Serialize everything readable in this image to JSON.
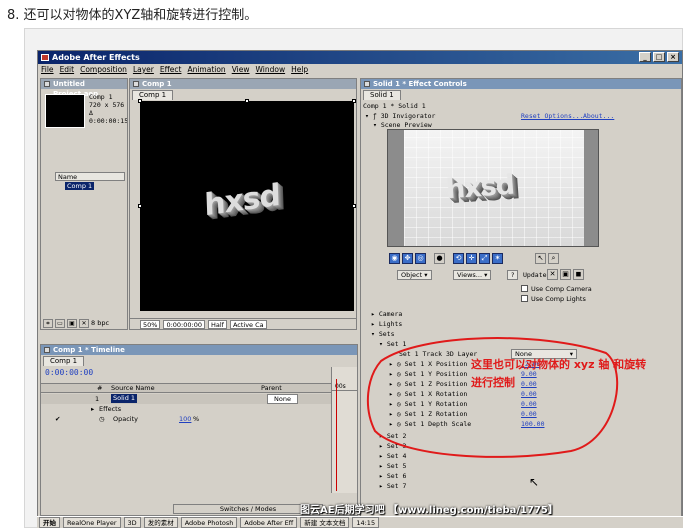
{
  "caption": "8. 还可以对物体的XYZ轴和旋转进行控制。",
  "app": {
    "title": "Adobe After Effects",
    "window_buttons": [
      "_",
      "□",
      "×"
    ],
    "menu": [
      "File",
      "Edit",
      "Composition",
      "Layer",
      "Effect",
      "Animation",
      "View",
      "Window",
      "Help"
    ]
  },
  "project": {
    "title": "Untitled Project.aep",
    "info": [
      "Comp 1",
      "720 x 576",
      "Δ 0:00:00:15"
    ],
    "column": "Name",
    "item": "Comp 1",
    "bpc": "8 bpc"
  },
  "comp": {
    "title": "Comp 1",
    "tab": "Comp 1",
    "logo": "hxsd",
    "zoom": "50%",
    "timecode": "0:00:00:00",
    "resolution": "Half",
    "camera": "Active Ca"
  },
  "timeline": {
    "title": "Comp 1 * Timeline",
    "tab": "Comp 1",
    "time": "0:00:00:00",
    "col_num": "#",
    "col_source": "Source Name",
    "col_parent": "Parent",
    "layer_num": "1",
    "layer_name": "Solid 1",
    "parent_value": "None",
    "effects_label": "Effects",
    "opacity_label": "Opacity",
    "opacity_value": "100",
    "opacity_unit": "%",
    "ruler_start": "00s",
    "switches": "Switches / Modes"
  },
  "effect": {
    "title": "Solid 1 * Effect Controls",
    "tab": "Solid 1",
    "breadcrumb": "Comp 1 * Solid 1",
    "effect_name": "3D Invigorator",
    "reset": "Reset Options...",
    "about": "About...",
    "preview_label": "Scene Preview",
    "object_button": "Object",
    "views_button": "Views...",
    "help_button": "?",
    "update_label": "Update",
    "use_camera": "Use Comp Camera",
    "use_lights": "Use Comp Lights",
    "camera": "Camera",
    "lights": "Lights",
    "sets": "Sets",
    "set1": "Set 1",
    "track_label": "Set 1 Track 3D Layer",
    "track_value": "None",
    "params": [
      {
        "label": "Set 1 X Position",
        "value": "-2.00"
      },
      {
        "label": "Set 1 Y Position",
        "value": "9.00"
      },
      {
        "label": "Set 1 Z Position",
        "value": "0.00"
      },
      {
        "label": "Set 1 X Rotation",
        "value": "0.00"
      },
      {
        "label": "Set 1 Y Rotation",
        "value": "0.00"
      },
      {
        "label": "Set 1 Z Rotation",
        "value": "0.00"
      },
      {
        "label": "Set 1 Depth Scale",
        "value": "100.00"
      }
    ],
    "more_sets": [
      "Set 2",
      "Set 3",
      "Set 4",
      "Set 5",
      "Set 6",
      "Set 7"
    ],
    "note_line1": "这里也可以对物体的 xyz 轴 和旋转",
    "note_line2": "进行控制",
    "note_color": "#e01a1a"
  },
  "taskbar": [
    "开始",
    "RealOne Player",
    "3D",
    "发的素材",
    "Adobe Photosh",
    "Adobe After Eff",
    "新建 文本文档",
    "14:15"
  ],
  "watermark": "图云AE后期学习吧 【www.lineg.com/tieba/1775】"
}
